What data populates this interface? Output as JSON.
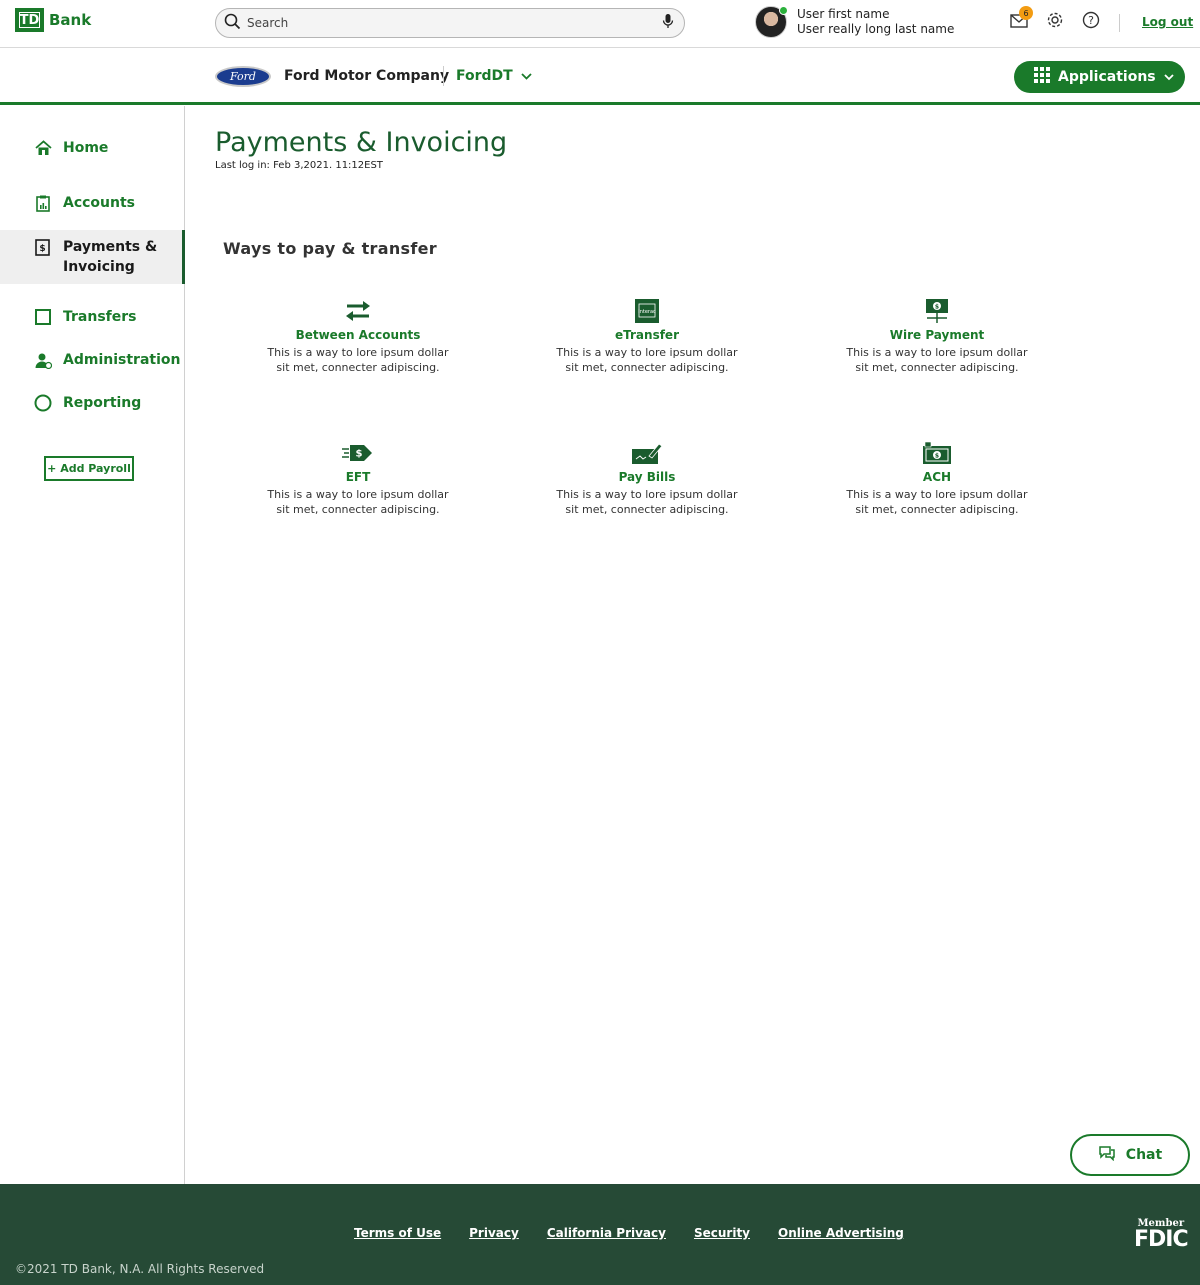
{
  "header": {
    "logo_mark": "TD",
    "logo_text": "Bank",
    "search_placeholder": "Search",
    "user_first_name": "User first name",
    "user_last_name": "User really long last name",
    "notification_count": "6",
    "logout_label": "Log out"
  },
  "subheader": {
    "company_logo_text": "Ford",
    "company_name": "Ford Motor Company",
    "account_selector": "FordDT",
    "applications_label": "Applications"
  },
  "sidebar": {
    "items": [
      {
        "label": "Home",
        "icon": "home-icon"
      },
      {
        "label": "Accounts",
        "icon": "accounts-icon"
      },
      {
        "label": "Payments &",
        "label2": "Invoicing",
        "icon": "payments-icon",
        "active": true
      },
      {
        "label": "Transfers",
        "icon": "transfers-icon"
      },
      {
        "label": "Administration",
        "icon": "administration-icon"
      },
      {
        "label": "Reporting",
        "icon": "reporting-icon"
      }
    ],
    "add_payroll_label": "+ Add Payroll"
  },
  "main": {
    "title": "Payments & Invoicing",
    "last_login": "Last log in: Feb 3,2021. 11:12EST",
    "section_title": "Ways to pay & transfer",
    "options": [
      {
        "title": "Between Accounts",
        "desc": "This is a way to lore ipsum dollar sit met, connecter adipiscing.",
        "icon": "transfer-arrows-icon"
      },
      {
        "title": "eTransfer",
        "desc": "This is a way to lore ipsum dollar sit met, connecter adipiscing.",
        "icon": "interac-icon"
      },
      {
        "title": "Wire Payment",
        "desc": "This is a way to lore ipsum dollar sit met, connecter adipiscing.",
        "icon": "wire-icon"
      },
      {
        "title": "EFT",
        "desc": "This is a way to lore ipsum dollar sit met, connecter adipiscing.",
        "icon": "eft-icon"
      },
      {
        "title": "Pay Bills",
        "desc": "This is a way to lore ipsum dollar sit met, connecter adipiscing.",
        "icon": "pay-bills-icon"
      },
      {
        "title": "ACH",
        "desc": "This is a way to lore ipsum dollar sit met, connecter adipiscing.",
        "icon": "ach-icon"
      }
    ]
  },
  "chat": {
    "label": "Chat"
  },
  "footer": {
    "links": [
      "Terms of Use",
      "Privacy",
      "California Privacy",
      "Security",
      "Online Advertising"
    ],
    "copyright": "©2021 TD Bank, N.A. All Rights Reserved",
    "fdic_member": "Member",
    "fdic_text": "FDIC"
  },
  "colors": {
    "brand_green": "#1a7a2a",
    "dark_green": "#1a5c2e",
    "footer_bg": "#264a36"
  }
}
